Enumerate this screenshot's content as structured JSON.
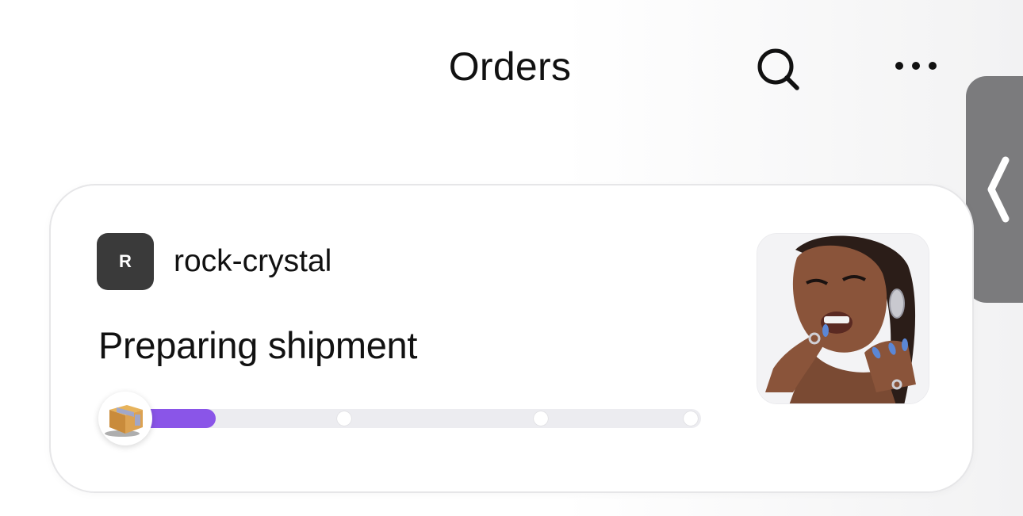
{
  "header": {
    "title": "Orders"
  },
  "order": {
    "shop_initial": "R",
    "shop_name": "rock-crystal",
    "status": "Preparing shipment",
    "progress": 0.16
  },
  "icons": {
    "search": "search-icon",
    "more": "more-horizontal-icon",
    "handle": "chevron-left-icon",
    "package": "package-box-icon"
  },
  "colors": {
    "accent": "#8a55e8",
    "avatar_bg": "#3a3a3a",
    "handle_bg": "#7b7b7d"
  }
}
